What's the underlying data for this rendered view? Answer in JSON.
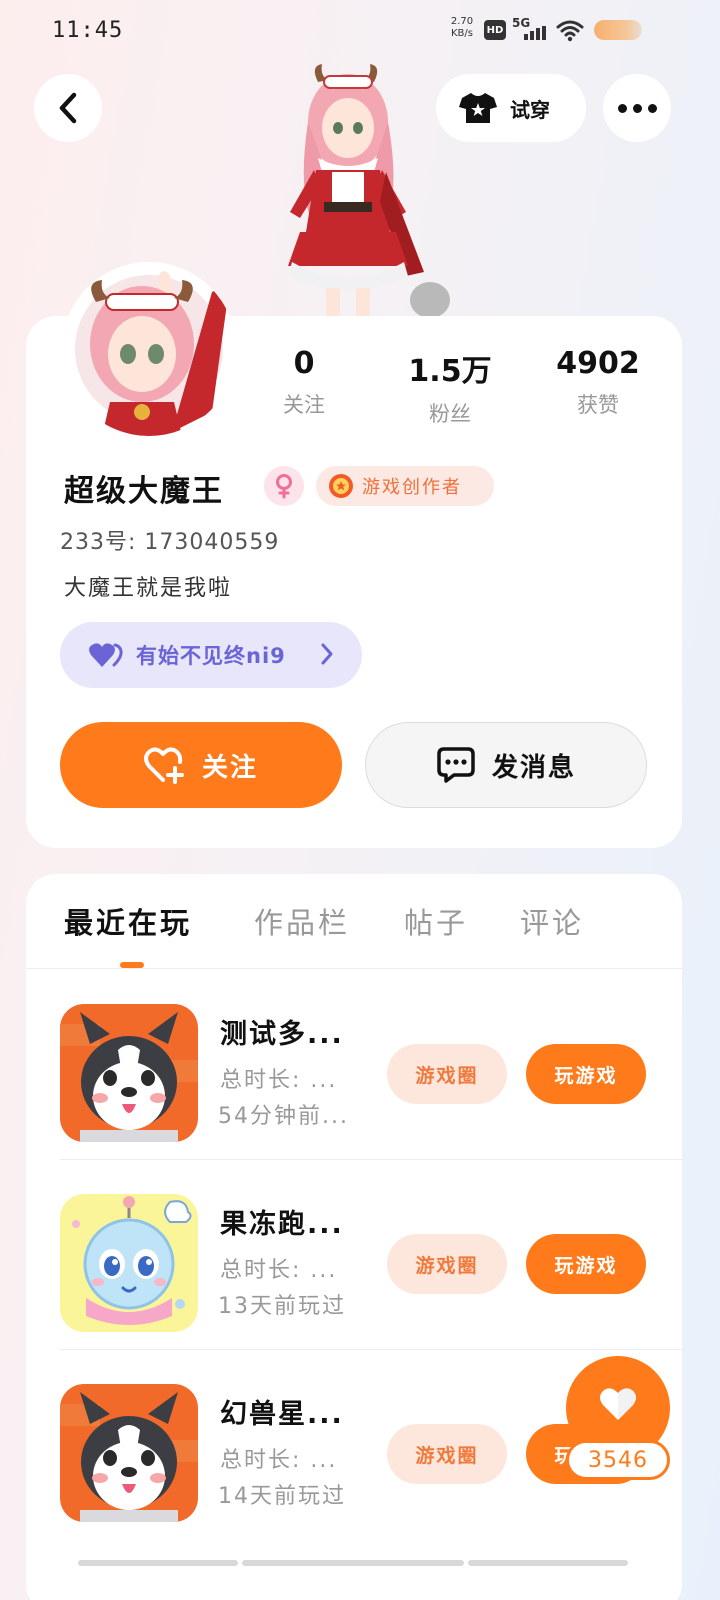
{
  "status_bar": {
    "time": "11:45",
    "net_speed_value": "2.70",
    "net_speed_unit": "KB/s",
    "hd": "HD",
    "network": "5G",
    "icons": [
      "signal-icon",
      "wifi-icon",
      "battery-icon"
    ]
  },
  "nav": {
    "tryon_label": "试穿",
    "icons": [
      "back-arrow-icon",
      "tshirt-icon",
      "more-dots-icon"
    ]
  },
  "profile": {
    "stats": [
      {
        "value": "0",
        "label": "关注"
      },
      {
        "value": "1.5万",
        "label": "粉丝"
      },
      {
        "value": "4902",
        "label": "获赞"
      }
    ],
    "username": "超级大魔王",
    "gender": "female",
    "creator_badge": "游戏创作者",
    "uid": "233号: 173040559",
    "bio": "大魔王就是我啦",
    "signature": "有始不见终ni9",
    "follow_label": "关注",
    "message_label": "发消息"
  },
  "tabs": [
    {
      "label": "最近在玩",
      "active": true
    },
    {
      "label": "作品栏",
      "active": false
    },
    {
      "label": "帖子",
      "active": false
    },
    {
      "label": "评论",
      "active": false
    }
  ],
  "games": [
    {
      "title": "测试多...",
      "duration": "总时长: ...",
      "last_played": "54分钟前...",
      "icon": "husky-dog-icon",
      "circle_label": "游戏圈",
      "play_label": "玩游戏"
    },
    {
      "title": "果冻跑...",
      "duration": "总时长: ...",
      "last_played": "13天前玩过",
      "icon": "jelly-robot-icon",
      "circle_label": "游戏圈",
      "play_label": "玩游戏"
    },
    {
      "title": "幻兽星...",
      "duration": "总时长: ...",
      "last_played": "14天前玩过",
      "icon": "husky-dog-icon",
      "circle_label": "游戏圈",
      "play_label": "玩游戏"
    }
  ],
  "floating_like": {
    "count": "3546"
  },
  "colors": {
    "accent": "#ff7a1a",
    "signature_bg": "#e8e6fb",
    "signature_text": "#6a64d6",
    "badge_bg": "#fde9e4"
  }
}
